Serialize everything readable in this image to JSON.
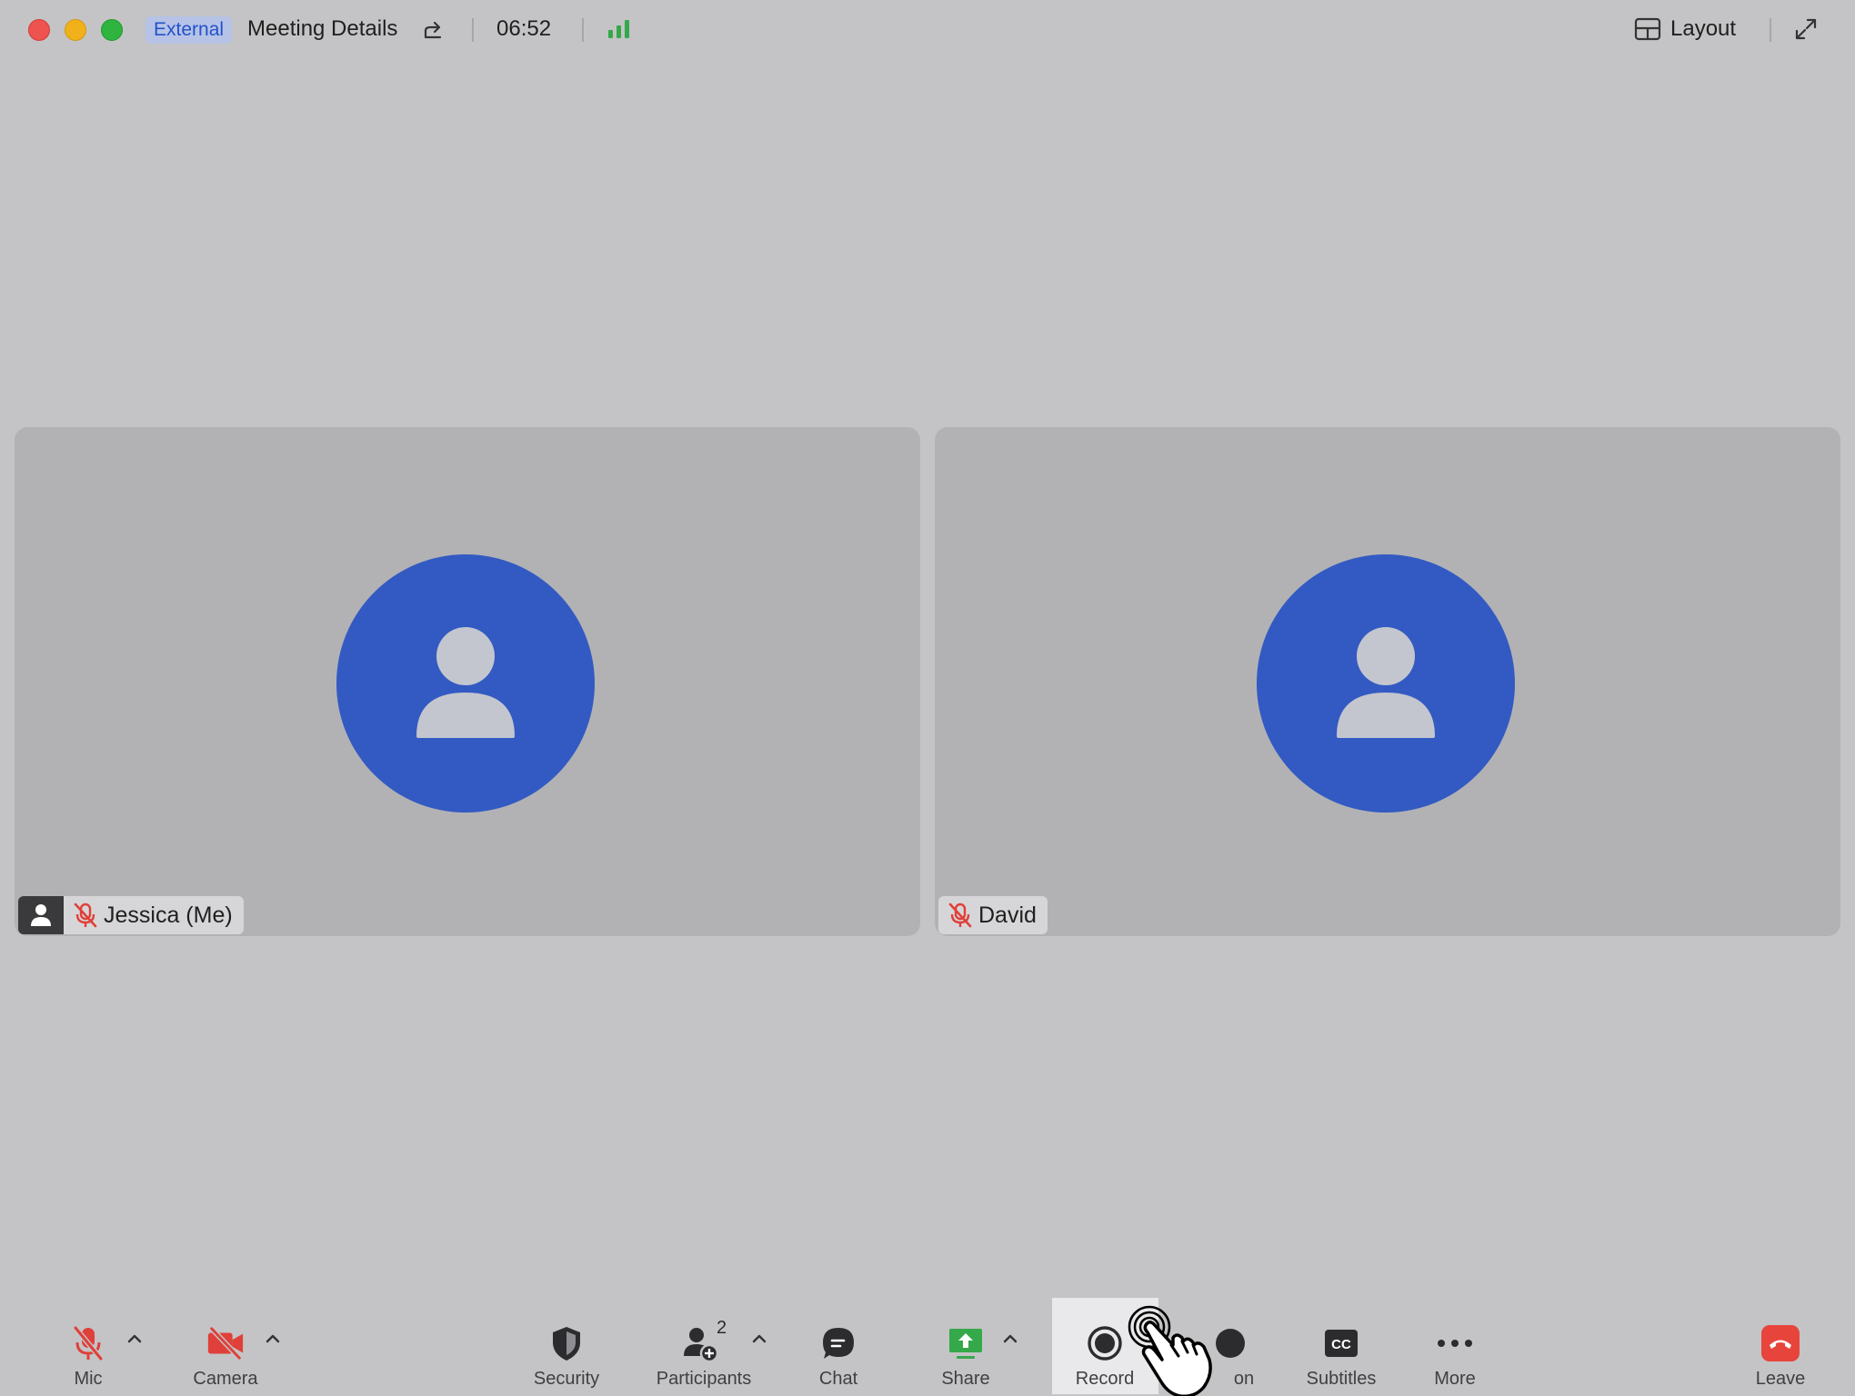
{
  "titlebar": {
    "badge": "External",
    "meeting_title": "Meeting Details",
    "timer": "06:52",
    "layout_label": "Layout"
  },
  "participants": [
    {
      "name": "Jessica (Me)",
      "mic_muted": true,
      "video_off": true
    },
    {
      "name": "David",
      "mic_muted": true,
      "video_off": true
    }
  ],
  "toolbar": {
    "mic": "Mic",
    "camera": "Camera",
    "security": "Security",
    "participants": "Participants",
    "participants_count": "2",
    "chat": "Chat",
    "share": "Share",
    "record": "Record",
    "reaction_partial": "on",
    "subtitles": "Subtitles",
    "more": "More",
    "leave": "Leave"
  },
  "colors": {
    "background": "#c4c4c6",
    "tile": "#b2b2b5",
    "avatar": "#335ac2",
    "muted_red": "#e0403a",
    "share_green": "#35a84a",
    "leave_red": "#e7453c"
  }
}
